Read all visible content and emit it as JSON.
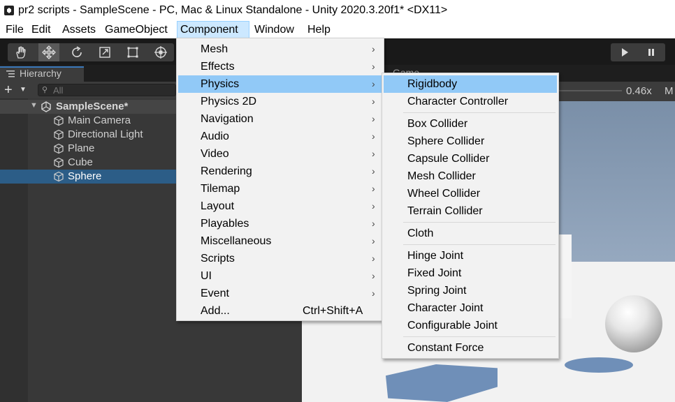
{
  "window": {
    "title": "pr2 scripts - SampleScene - PC, Mac & Linux Standalone - Unity 2020.3.20f1* <DX11>"
  },
  "menubar": [
    "File",
    "Edit",
    "Assets",
    "GameObject",
    "Component",
    "Window",
    "Help"
  ],
  "active_menu": "Component",
  "toolbar": {
    "tools": [
      "hand-tool-icon",
      "move-tool-icon",
      "rotate-tool-icon",
      "scale-tool-icon",
      "rect-tool-icon",
      "transform-tool-icon"
    ],
    "active_tool": "move-tool-icon"
  },
  "hierarchy": {
    "tab_label": "Hierarchy",
    "add_label": "+",
    "search_placeholder": "All",
    "scene": "SampleScene*",
    "items": [
      "Main Camera",
      "Directional Light",
      "Plane",
      "Cube",
      "Sphere"
    ],
    "selected": "Sphere"
  },
  "game_view": {
    "tab_label": "Game",
    "scale_label": "0.46x",
    "aspect_label": "M"
  },
  "component_menu": {
    "items": [
      {
        "label": "Mesh",
        "submenu": true
      },
      {
        "label": "Effects",
        "submenu": true
      },
      {
        "label": "Physics",
        "submenu": true
      },
      {
        "label": "Physics 2D",
        "submenu": true
      },
      {
        "label": "Navigation",
        "submenu": true
      },
      {
        "label": "Audio",
        "submenu": true
      },
      {
        "label": "Video",
        "submenu": true
      },
      {
        "label": "Rendering",
        "submenu": true
      },
      {
        "label": "Tilemap",
        "submenu": true
      },
      {
        "label": "Layout",
        "submenu": true
      },
      {
        "label": "Playables",
        "submenu": true
      },
      {
        "label": "Miscellaneous",
        "submenu": true
      },
      {
        "label": "Scripts",
        "submenu": true
      },
      {
        "label": "UI",
        "submenu": true
      },
      {
        "label": "Event",
        "submenu": true
      },
      {
        "label": "Add...",
        "shortcut": "Ctrl+Shift+A"
      }
    ],
    "highlighted": "Physics"
  },
  "physics_menu": {
    "groups": [
      [
        "Rigidbody",
        "Character Controller"
      ],
      [
        "Box Collider",
        "Sphere Collider",
        "Capsule Collider",
        "Mesh Collider",
        "Wheel Collider",
        "Terrain Collider"
      ],
      [
        "Cloth"
      ],
      [
        "Hinge Joint",
        "Fixed Joint",
        "Spring Joint",
        "Character Joint",
        "Configurable Joint"
      ],
      [
        "Constant Force"
      ]
    ],
    "highlighted": "Rigidbody"
  }
}
